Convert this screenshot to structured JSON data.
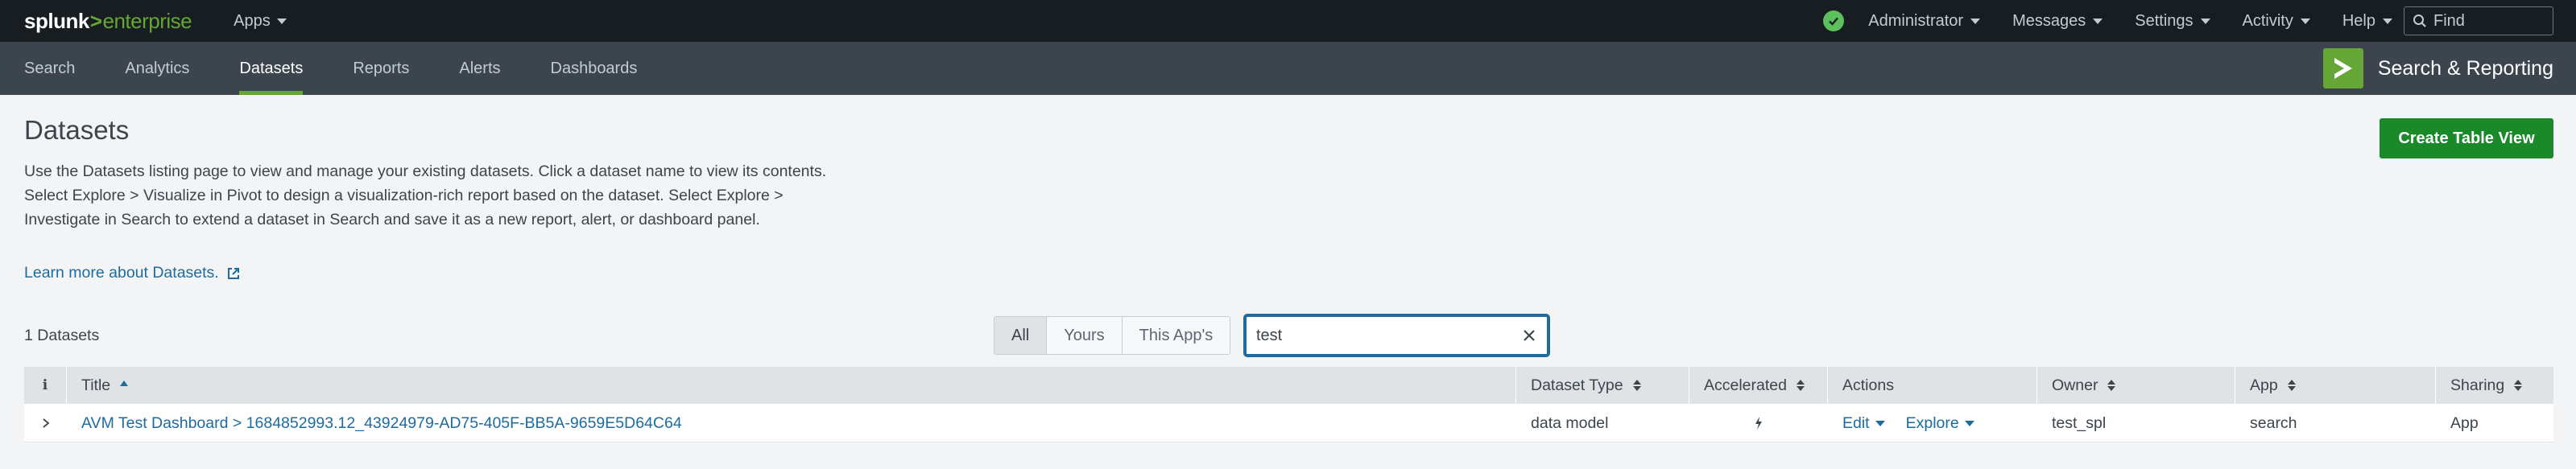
{
  "topbar": {
    "logo": {
      "part1": "splunk",
      "part2": ">",
      "part3": "enterprise"
    },
    "apps_label": "Apps",
    "status_icon": "check-circle-icon",
    "menus": [
      "Administrator",
      "Messages",
      "Settings",
      "Activity",
      "Help"
    ],
    "find_placeholder": "Find"
  },
  "appbar": {
    "nav": [
      {
        "label": "Search",
        "active": false
      },
      {
        "label": "Analytics",
        "active": false
      },
      {
        "label": "Datasets",
        "active": true
      },
      {
        "label": "Reports",
        "active": false
      },
      {
        "label": "Alerts",
        "active": false
      },
      {
        "label": "Dashboards",
        "active": false
      }
    ],
    "app_name": "Search & Reporting"
  },
  "page": {
    "title": "Datasets",
    "description": "Use the Datasets listing page to view and manage your existing datasets. Click a dataset name to view its contents. Select Explore > Visualize in Pivot to design a visualization-rich report based on the dataset. Select Explore > Investigate in Search to extend a dataset in Search and save it as a new report, alert, or dashboard panel.",
    "learn_more": "Learn more about Datasets.",
    "create_button": "Create Table View"
  },
  "controls": {
    "count": "1 Datasets",
    "filters": [
      {
        "label": "All",
        "active": true
      },
      {
        "label": "Yours",
        "active": false
      },
      {
        "label": "This App's",
        "active": false
      }
    ],
    "search_value": "test"
  },
  "table": {
    "headers": {
      "info": "i",
      "title": "Title",
      "type": "Dataset Type",
      "accelerated": "Accelerated",
      "actions": "Actions",
      "owner": "Owner",
      "app": "App",
      "sharing": "Sharing"
    },
    "rows": [
      {
        "title": "AVM Test Dashboard > 1684852993.12_43924979-AD75-405F-BB5A-9659E5D64C64",
        "type": "data model",
        "accelerated_icon": "lightning-bolt-icon",
        "edit": "Edit",
        "explore": "Explore",
        "owner": "test_spl",
        "app": "search",
        "sharing": "App"
      }
    ]
  },
  "colors": {
    "topbar_bg": "#171d21",
    "appbar_bg": "#3c444d",
    "brand_green": "#65a637",
    "primary_button": "#1a8929",
    "link": "#1e6b9e",
    "status_ok": "#5cc05c"
  }
}
